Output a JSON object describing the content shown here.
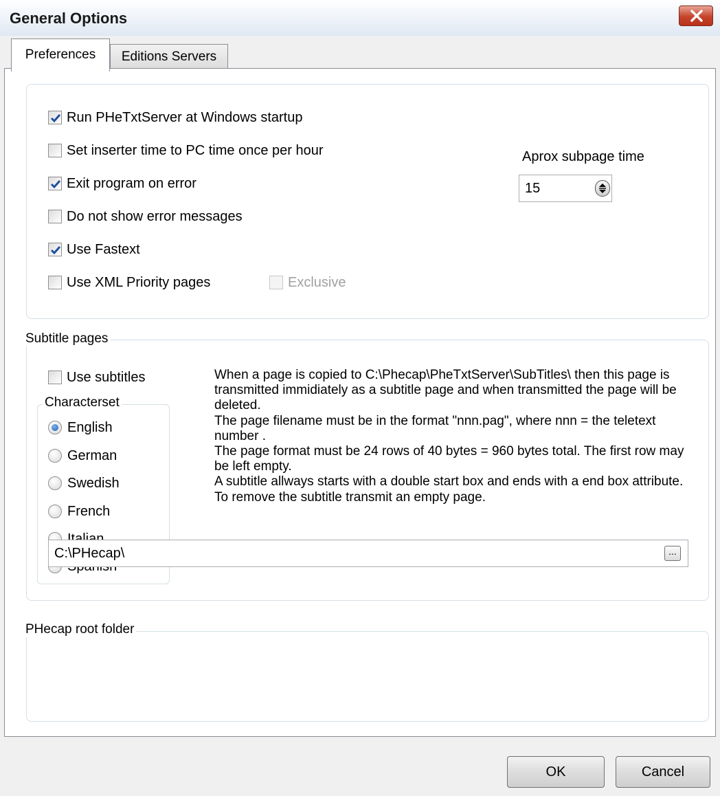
{
  "window": {
    "title": "General Options",
    "close_icon": "close-icon"
  },
  "tabs": [
    {
      "label": "Preferences",
      "active": true
    },
    {
      "label": "Editions Servers",
      "active": false
    }
  ],
  "options": {
    "run_at_startup": {
      "label": "Run PHeTxtServer at Windows startup",
      "checked": true
    },
    "set_inserter_time": {
      "label": "Set inserter time to PC time once per hour",
      "checked": false
    },
    "exit_on_error": {
      "label": "Exit program on error",
      "checked": true
    },
    "hide_errors": {
      "label": "Do not show error messages",
      "checked": false
    },
    "use_fastext": {
      "label": "Use Fastext",
      "checked": true
    },
    "use_xml_priority": {
      "label": "Use XML Priority pages",
      "checked": false
    },
    "exclusive": {
      "label": "Exclusive",
      "checked": false,
      "enabled": false
    }
  },
  "subpage_time": {
    "label": "Aprox subpage time",
    "value": "15"
  },
  "subtitle_pages": {
    "legend": "Subtitle pages",
    "use_subtitles": {
      "label": "Use subtitles",
      "checked": false
    },
    "characterset": {
      "legend": "Characterset",
      "options": [
        "English",
        "German",
        "Swedish",
        "French",
        "Italian",
        "Spanish"
      ],
      "selected": "English"
    },
    "description": [
      "When a page is copied to C:\\Phecap\\PheTxtServer\\SubTitles\\ then this page is transmitted immidiately as a subtitle page and when transmitted the page will be deleted.",
      "The page filename must be in the format \"nnn.pag\", where nnn = the teletext number .",
      "The page format must be 24 rows of 40 bytes = 960 bytes total. The first row may be left empty.",
      "A subtitle allways starts with a double start box and ends with a end box attribute. To remove the subtitle transmit an empty page."
    ]
  },
  "root_folder": {
    "legend": "PHecap root folder",
    "value": "C:\\PHecap\\",
    "browse_label": "..."
  },
  "buttons": {
    "ok": "OK",
    "cancel": "Cancel"
  }
}
